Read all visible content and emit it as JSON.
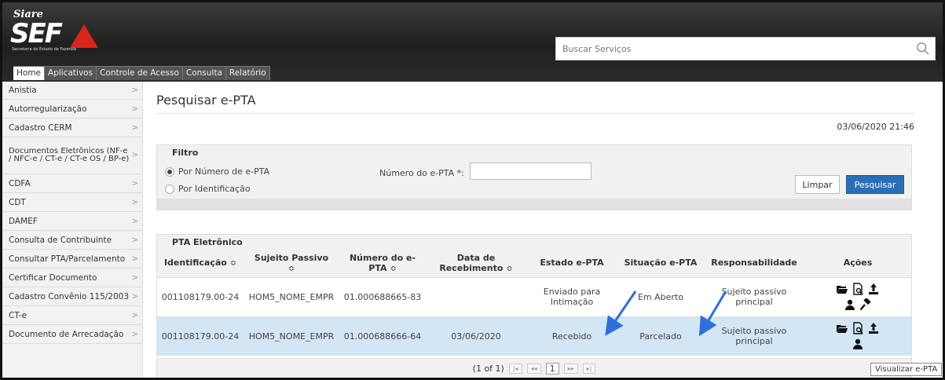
{
  "app": {
    "logo_top": "Siare",
    "logo_main": "SEF",
    "logo_sub": "Secretaria de Estado de Fazenda"
  },
  "search": {
    "placeholder": "Buscar Serviços"
  },
  "topnav": [
    {
      "label": "Home",
      "active": true
    },
    {
      "label": "Aplicativos"
    },
    {
      "label": "Controle de Acesso"
    },
    {
      "label": "Consulta"
    },
    {
      "label": "Relatório"
    }
  ],
  "sidebar": [
    "Anistia",
    "Autorregularização",
    "Cadastro CERM",
    "Documentos Eletrônicos (NF-e / NFC-e / CT-e / CT-e OS / BP-e)",
    "CDFA",
    "CDT",
    "DAMEF",
    "Consulta de Contribuinte",
    "Consultar PTA/Parcelamento",
    "Certificar Documento",
    "Cadastro Convênio 115/2003",
    "CT-e",
    "Documento de Arrecadação"
  ],
  "page": {
    "title": "Pesquisar e-PTA",
    "datetime": "03/06/2020 21:46"
  },
  "filter": {
    "header": "Filtro",
    "option_number": "Por Número de e-PTA",
    "option_id": "Por Identificação",
    "number_label": "Número do e-PTA *:",
    "number_value": "",
    "clear_label": "Limpar",
    "search_label": "Pesquisar"
  },
  "results": {
    "header": "PTA Eletrônico",
    "columns": [
      "Identificação",
      "Sujeito Passivo",
      "Número do e-PTA",
      "Data de Recebimento",
      "Estado e-PTA",
      "Situação e-PTA",
      "Responsabilidade",
      "Ações"
    ],
    "sort_glyph": "≎",
    "rows": [
      {
        "id": "001108179.00-24",
        "sujeito": "HOM5_NOME_EMPR",
        "numero": "01.000688665-83",
        "data": "",
        "estado": "Enviado para Intimação",
        "situacao": "Em Aberto",
        "resp": "Sujeito passivo principal"
      },
      {
        "id": "001108179.00-24",
        "sujeito": "HOM5_NOME_EMPR",
        "numero": "01.000688666-64",
        "data": "03/06/2020",
        "estado": "Recebido",
        "situacao": "Parcelado",
        "resp": "Sujeito passivo principal"
      }
    ],
    "pager_text": "(1 of 1)",
    "pager_current": "1",
    "pager_first": "|◂",
    "pager_prev": "◂◂",
    "pager_next": "▸▸",
    "pager_last": "▸|"
  },
  "tooltip": "Visualizar e-PTA",
  "colors": {
    "primary": "#2a6fb6",
    "selected_row": "#d3e6f5",
    "arrow": "#2f6fd6",
    "logo_red": "#d9261c"
  }
}
